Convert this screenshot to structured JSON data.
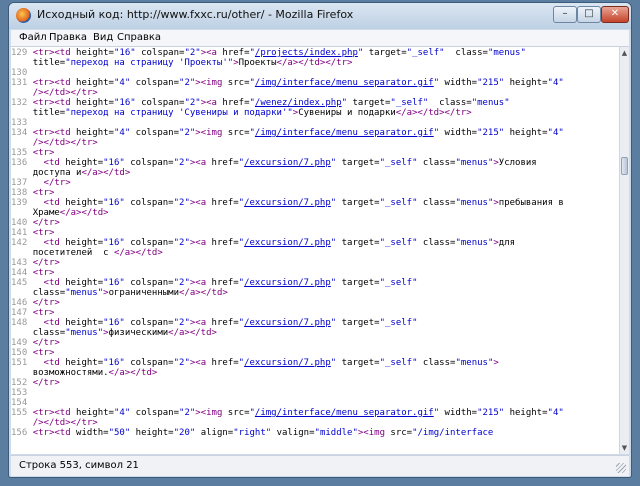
{
  "window": {
    "title": "Исходный код: http://www.fxxc.ru/other/ - Mozilla Firefox",
    "minimize_glyph": "–",
    "maximize_glyph": "□",
    "close_glyph": "✕"
  },
  "menu": {
    "items": [
      "Файл",
      "Правка",
      "Вид",
      "Справка"
    ]
  },
  "code_lines": [
    [
      {
        "t": "ln",
        "v": "129 "
      },
      {
        "t": "tag",
        "v": "<tr><td"
      },
      {
        "t": "attr",
        "v": " height="
      },
      {
        "t": "str",
        "v": "\"16\""
      },
      {
        "t": "attr",
        "v": " colspan="
      },
      {
        "t": "str",
        "v": "\"2\""
      },
      {
        "t": "tag",
        "v": "><a"
      },
      {
        "t": "attr",
        "v": " href="
      },
      {
        "t": "str",
        "v": "\""
      },
      {
        "t": "lnk",
        "v": "/projects/index.php"
      },
      {
        "t": "str",
        "v": "\""
      },
      {
        "t": "attr",
        "v": " target="
      },
      {
        "t": "str",
        "v": "\"_self\""
      },
      {
        "t": "attr",
        "v": "  class="
      },
      {
        "t": "str",
        "v": "\"menus\""
      }
    ],
    [
      {
        "t": "ln",
        "v": "    "
      },
      {
        "t": "attr",
        "v": "title="
      },
      {
        "t": "str",
        "v": "\"переход на страницу 'Проекты'\""
      },
      {
        "t": "tag",
        "v": ">"
      },
      {
        "t": "attr",
        "v": "Проекты"
      },
      {
        "t": "tag",
        "v": "</a></td></tr>"
      }
    ],
    [
      {
        "t": "ln",
        "v": "130 "
      }
    ],
    [
      {
        "t": "ln",
        "v": "131 "
      },
      {
        "t": "tag",
        "v": "<tr><td"
      },
      {
        "t": "attr",
        "v": " height="
      },
      {
        "t": "str",
        "v": "\"4\""
      },
      {
        "t": "attr",
        "v": " colspan="
      },
      {
        "t": "str",
        "v": "\"2\""
      },
      {
        "t": "tag",
        "v": "><img"
      },
      {
        "t": "attr",
        "v": " src="
      },
      {
        "t": "str",
        "v": "\""
      },
      {
        "t": "lnk",
        "v": "/img/interface/menu_separator.gif"
      },
      {
        "t": "str",
        "v": "\""
      },
      {
        "t": "attr",
        "v": " width="
      },
      {
        "t": "str",
        "v": "\"215\""
      },
      {
        "t": "attr",
        "v": " height="
      },
      {
        "t": "str",
        "v": "\"4\""
      }
    ],
    [
      {
        "t": "ln",
        "v": "    "
      },
      {
        "t": "tag",
        "v": "/></td></tr>"
      }
    ],
    [
      {
        "t": "ln",
        "v": "132 "
      },
      {
        "t": "tag",
        "v": "<tr><td"
      },
      {
        "t": "attr",
        "v": " height="
      },
      {
        "t": "str",
        "v": "\"16\""
      },
      {
        "t": "attr",
        "v": " colspan="
      },
      {
        "t": "str",
        "v": "\"2\""
      },
      {
        "t": "tag",
        "v": "><a"
      },
      {
        "t": "attr",
        "v": " href="
      },
      {
        "t": "str",
        "v": "\""
      },
      {
        "t": "lnk",
        "v": "/wenez/index.php"
      },
      {
        "t": "str",
        "v": "\""
      },
      {
        "t": "attr",
        "v": " target="
      },
      {
        "t": "str",
        "v": "\"_self\""
      },
      {
        "t": "attr",
        "v": "  class="
      },
      {
        "t": "str",
        "v": "\"menus\""
      }
    ],
    [
      {
        "t": "ln",
        "v": "    "
      },
      {
        "t": "attr",
        "v": "title="
      },
      {
        "t": "str",
        "v": "\"переход на страницу 'Сувениры и подарки'\""
      },
      {
        "t": "tag",
        "v": ">"
      },
      {
        "t": "attr",
        "v": "Сувениры и подарки"
      },
      {
        "t": "tag",
        "v": "</a></td></tr>"
      }
    ],
    [
      {
        "t": "ln",
        "v": "133 "
      }
    ],
    [
      {
        "t": "ln",
        "v": "134 "
      },
      {
        "t": "tag",
        "v": "<tr><td"
      },
      {
        "t": "attr",
        "v": " height="
      },
      {
        "t": "str",
        "v": "\"4\""
      },
      {
        "t": "attr",
        "v": " colspan="
      },
      {
        "t": "str",
        "v": "\"2\""
      },
      {
        "t": "tag",
        "v": "><img"
      },
      {
        "t": "attr",
        "v": " src="
      },
      {
        "t": "str",
        "v": "\""
      },
      {
        "t": "lnk",
        "v": "/img/interface/menu_separator.gif"
      },
      {
        "t": "str",
        "v": "\""
      },
      {
        "t": "attr",
        "v": " width="
      },
      {
        "t": "str",
        "v": "\"215\""
      },
      {
        "t": "attr",
        "v": " height="
      },
      {
        "t": "str",
        "v": "\"4\""
      }
    ],
    [
      {
        "t": "ln",
        "v": "    "
      },
      {
        "t": "tag",
        "v": "/></td></tr>"
      }
    ],
    [
      {
        "t": "ln",
        "v": "135 "
      },
      {
        "t": "tag",
        "v": "<tr>"
      }
    ],
    [
      {
        "t": "ln",
        "v": "136 "
      },
      {
        "t": "tag",
        "v": "  <td"
      },
      {
        "t": "attr",
        "v": " height="
      },
      {
        "t": "str",
        "v": "\"16\""
      },
      {
        "t": "attr",
        "v": " colspan="
      },
      {
        "t": "str",
        "v": "\"2\""
      },
      {
        "t": "tag",
        "v": "><a"
      },
      {
        "t": "attr",
        "v": " href="
      },
      {
        "t": "str",
        "v": "\""
      },
      {
        "t": "lnk",
        "v": "/excursion/7.php"
      },
      {
        "t": "str",
        "v": "\""
      },
      {
        "t": "attr",
        "v": " target="
      },
      {
        "t": "str",
        "v": "\"_self\""
      },
      {
        "t": "attr",
        "v": " class="
      },
      {
        "t": "str",
        "v": "\"menus\""
      },
      {
        "t": "tag",
        "v": ">"
      },
      {
        "t": "attr",
        "v": "Условия"
      }
    ],
    [
      {
        "t": "ln",
        "v": "    "
      },
      {
        "t": "attr",
        "v": "доступа и"
      },
      {
        "t": "tag",
        "v": "</a></td>"
      }
    ],
    [
      {
        "t": "ln",
        "v": "137 "
      },
      {
        "t": "tag",
        "v": "  </tr>"
      }
    ],
    [
      {
        "t": "ln",
        "v": "138 "
      },
      {
        "t": "tag",
        "v": "<tr>"
      }
    ],
    [
      {
        "t": "ln",
        "v": "139 "
      },
      {
        "t": "tag",
        "v": "  <td"
      },
      {
        "t": "attr",
        "v": " height="
      },
      {
        "t": "str",
        "v": "\"16\""
      },
      {
        "t": "attr",
        "v": " colspan="
      },
      {
        "t": "str",
        "v": "\"2\""
      },
      {
        "t": "tag",
        "v": "><a"
      },
      {
        "t": "attr",
        "v": " href="
      },
      {
        "t": "str",
        "v": "\""
      },
      {
        "t": "lnk",
        "v": "/excursion/7.php"
      },
      {
        "t": "str",
        "v": "\""
      },
      {
        "t": "attr",
        "v": " target="
      },
      {
        "t": "str",
        "v": "\"_self\""
      },
      {
        "t": "attr",
        "v": " class="
      },
      {
        "t": "str",
        "v": "\"menus\""
      },
      {
        "t": "tag",
        "v": ">"
      },
      {
        "t": "attr",
        "v": "пребывания в"
      }
    ],
    [
      {
        "t": "ln",
        "v": "    "
      },
      {
        "t": "attr",
        "v": "Храме"
      },
      {
        "t": "tag",
        "v": "</a></td>"
      }
    ],
    [
      {
        "t": "ln",
        "v": "140 "
      },
      {
        "t": "tag",
        "v": "</tr>"
      }
    ],
    [
      {
        "t": "ln",
        "v": "141 "
      },
      {
        "t": "tag",
        "v": "<tr>"
      }
    ],
    [
      {
        "t": "ln",
        "v": "142 "
      },
      {
        "t": "tag",
        "v": "  <td"
      },
      {
        "t": "attr",
        "v": " height="
      },
      {
        "t": "str",
        "v": "\"16\""
      },
      {
        "t": "attr",
        "v": " colspan="
      },
      {
        "t": "str",
        "v": "\"2\""
      },
      {
        "t": "tag",
        "v": "><a"
      },
      {
        "t": "attr",
        "v": " href="
      },
      {
        "t": "str",
        "v": "\""
      },
      {
        "t": "lnk",
        "v": "/excursion/7.php"
      },
      {
        "t": "str",
        "v": "\""
      },
      {
        "t": "attr",
        "v": " target="
      },
      {
        "t": "str",
        "v": "\"_self\""
      },
      {
        "t": "attr",
        "v": " class="
      },
      {
        "t": "str",
        "v": "\"menus\""
      },
      {
        "t": "tag",
        "v": ">"
      },
      {
        "t": "attr",
        "v": "для"
      }
    ],
    [
      {
        "t": "ln",
        "v": "    "
      },
      {
        "t": "attr",
        "v": "посетителей  с "
      },
      {
        "t": "tag",
        "v": "</a></td>"
      }
    ],
    [
      {
        "t": "ln",
        "v": "143 "
      },
      {
        "t": "tag",
        "v": "</tr>"
      }
    ],
    [
      {
        "t": "ln",
        "v": "144 "
      },
      {
        "t": "tag",
        "v": "<tr>"
      }
    ],
    [
      {
        "t": "ln",
        "v": "145 "
      },
      {
        "t": "tag",
        "v": "  <td"
      },
      {
        "t": "attr",
        "v": " height="
      },
      {
        "t": "str",
        "v": "\"16\""
      },
      {
        "t": "attr",
        "v": " colspan="
      },
      {
        "t": "str",
        "v": "\"2\""
      },
      {
        "t": "tag",
        "v": "><a"
      },
      {
        "t": "attr",
        "v": " href="
      },
      {
        "t": "str",
        "v": "\""
      },
      {
        "t": "lnk",
        "v": "/excursion/7.php"
      },
      {
        "t": "str",
        "v": "\""
      },
      {
        "t": "attr",
        "v": " target="
      },
      {
        "t": "str",
        "v": "\"_self\""
      }
    ],
    [
      {
        "t": "ln",
        "v": "    "
      },
      {
        "t": "attr",
        "v": "class="
      },
      {
        "t": "str",
        "v": "\"menus\""
      },
      {
        "t": "tag",
        "v": ">"
      },
      {
        "t": "attr",
        "v": "ограниченными"
      },
      {
        "t": "tag",
        "v": "</a></td>"
      }
    ],
    [
      {
        "t": "ln",
        "v": "146 "
      },
      {
        "t": "tag",
        "v": "</tr>"
      }
    ],
    [
      {
        "t": "ln",
        "v": "147 "
      },
      {
        "t": "tag",
        "v": "<tr>"
      }
    ],
    [
      {
        "t": "ln",
        "v": "148 "
      },
      {
        "t": "tag",
        "v": "  <td"
      },
      {
        "t": "attr",
        "v": " height="
      },
      {
        "t": "str",
        "v": "\"16\""
      },
      {
        "t": "attr",
        "v": " colspan="
      },
      {
        "t": "str",
        "v": "\"2\""
      },
      {
        "t": "tag",
        "v": "><a"
      },
      {
        "t": "attr",
        "v": " href="
      },
      {
        "t": "str",
        "v": "\""
      },
      {
        "t": "lnk",
        "v": "/excursion/7.php"
      },
      {
        "t": "str",
        "v": "\""
      },
      {
        "t": "attr",
        "v": " target="
      },
      {
        "t": "str",
        "v": "\"_self\""
      }
    ],
    [
      {
        "t": "ln",
        "v": "    "
      },
      {
        "t": "attr",
        "v": "class="
      },
      {
        "t": "str",
        "v": "\"menus\""
      },
      {
        "t": "tag",
        "v": ">"
      },
      {
        "t": "attr",
        "v": "физическими"
      },
      {
        "t": "tag",
        "v": "</a></td>"
      }
    ],
    [
      {
        "t": "ln",
        "v": "149 "
      },
      {
        "t": "tag",
        "v": "</tr>"
      }
    ],
    [
      {
        "t": "ln",
        "v": "150 "
      },
      {
        "t": "tag",
        "v": "<tr>"
      }
    ],
    [
      {
        "t": "ln",
        "v": "151 "
      },
      {
        "t": "tag",
        "v": "  <td"
      },
      {
        "t": "attr",
        "v": " height="
      },
      {
        "t": "str",
        "v": "\"16\""
      },
      {
        "t": "attr",
        "v": " colspan="
      },
      {
        "t": "str",
        "v": "\"2\""
      },
      {
        "t": "tag",
        "v": "><a"
      },
      {
        "t": "attr",
        "v": " href="
      },
      {
        "t": "str",
        "v": "\""
      },
      {
        "t": "lnk",
        "v": "/excursion/7.php"
      },
      {
        "t": "str",
        "v": "\""
      },
      {
        "t": "attr",
        "v": " target="
      },
      {
        "t": "str",
        "v": "\"_self\""
      },
      {
        "t": "attr",
        "v": " class="
      },
      {
        "t": "str",
        "v": "\"menus\""
      },
      {
        "t": "tag",
        "v": ">"
      }
    ],
    [
      {
        "t": "ln",
        "v": "    "
      },
      {
        "t": "attr",
        "v": "возможностями."
      },
      {
        "t": "tag",
        "v": "</a></td>"
      }
    ],
    [
      {
        "t": "ln",
        "v": "152 "
      },
      {
        "t": "tag",
        "v": "</tr>"
      }
    ],
    [
      {
        "t": "ln",
        "v": "153 "
      }
    ],
    [
      {
        "t": "ln",
        "v": "154 "
      }
    ],
    [
      {
        "t": "ln",
        "v": "155 "
      },
      {
        "t": "tag",
        "v": "<tr><td"
      },
      {
        "t": "attr",
        "v": " height="
      },
      {
        "t": "str",
        "v": "\"4\""
      },
      {
        "t": "attr",
        "v": " colspan="
      },
      {
        "t": "str",
        "v": "\"2\""
      },
      {
        "t": "tag",
        "v": "><img"
      },
      {
        "t": "attr",
        "v": " src="
      },
      {
        "t": "str",
        "v": "\""
      },
      {
        "t": "lnk",
        "v": "/img/interface/menu_separator.gif"
      },
      {
        "t": "str",
        "v": "\""
      },
      {
        "t": "attr",
        "v": " width="
      },
      {
        "t": "str",
        "v": "\"215\""
      },
      {
        "t": "attr",
        "v": " height="
      },
      {
        "t": "str",
        "v": "\"4\""
      }
    ],
    [
      {
        "t": "ln",
        "v": "    "
      },
      {
        "t": "tag",
        "v": "/></td></tr>"
      }
    ],
    [
      {
        "t": "ln",
        "v": "156 "
      },
      {
        "t": "tag",
        "v": "<tr><td"
      },
      {
        "t": "attr",
        "v": " width="
      },
      {
        "t": "str",
        "v": "\"50\""
      },
      {
        "t": "attr",
        "v": " height="
      },
      {
        "t": "str",
        "v": "\"20\""
      },
      {
        "t": "attr",
        "v": " align="
      },
      {
        "t": "str",
        "v": "\"right\""
      },
      {
        "t": "attr",
        "v": " valign="
      },
      {
        "t": "str",
        "v": "\"middle\""
      },
      {
        "t": "tag",
        "v": "><img"
      },
      {
        "t": "attr",
        "v": " src="
      },
      {
        "t": "str",
        "v": "\"/img/interface"
      }
    ]
  ],
  "status": {
    "text": "Строка 553, символ 21"
  }
}
